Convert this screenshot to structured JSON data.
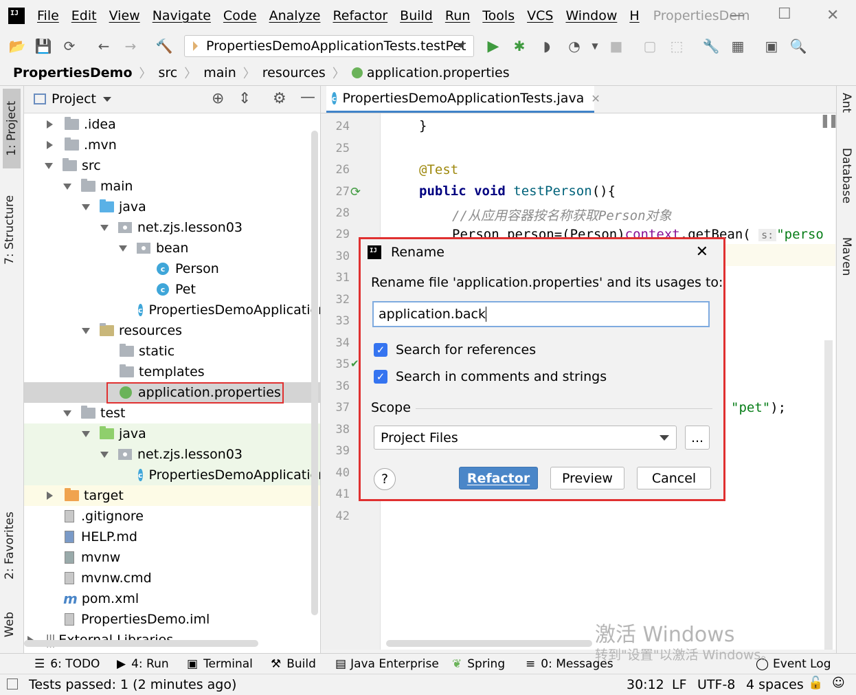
{
  "menubar": {
    "items": [
      "File",
      "Edit",
      "View",
      "Navigate",
      "Code",
      "Analyze",
      "Refactor",
      "Build",
      "Run",
      "Tools",
      "VCS",
      "Window",
      "H"
    ],
    "title": "PropertiesDem"
  },
  "toolbar": {
    "run_config": "PropertiesDemoApplicationTests.testPet"
  },
  "breadcrumb": [
    "PropertiesDemo",
    "src",
    "main",
    "resources",
    "application.properties"
  ],
  "left_tabs": {
    "project": "1: Project",
    "structure": "7: Structure",
    "favorites": "2: Favorites",
    "web": "Web"
  },
  "project_panel": {
    "title": "Project",
    "tree": [
      {
        "label": ".idea"
      },
      {
        "label": ".mvn"
      },
      {
        "label": "src"
      },
      {
        "label": "main"
      },
      {
        "label": "java"
      },
      {
        "label": "net.zjs.lesson03"
      },
      {
        "label": "bean"
      },
      {
        "label": "Person"
      },
      {
        "label": "Pet"
      },
      {
        "label": "PropertiesDemoApplication"
      },
      {
        "label": "resources"
      },
      {
        "label": "static"
      },
      {
        "label": "templates"
      },
      {
        "label": "application.properties"
      },
      {
        "label": "test"
      },
      {
        "label": "java"
      },
      {
        "label": "net.zjs.lesson03"
      },
      {
        "label": "PropertiesDemoApplication"
      },
      {
        "label": "target"
      },
      {
        "label": ".gitignore"
      },
      {
        "label": "HELP.md"
      },
      {
        "label": "mvnw"
      },
      {
        "label": "mvnw.cmd"
      },
      {
        "label": "pom.xml"
      },
      {
        "label": "PropertiesDemo.iml"
      },
      {
        "label": "External Libraries"
      }
    ]
  },
  "editor": {
    "tab": "PropertiesDemoApplicationTests.java",
    "line_numbers": [
      "24",
      "25",
      "26",
      "27",
      "28",
      "29",
      "30",
      "31",
      "32",
      "33",
      "34",
      "35",
      "36",
      "37",
      "38",
      "39",
      "40",
      "41",
      "42"
    ],
    "code": {
      "l24": "}",
      "l26": "@Test",
      "l27_kw": "public void",
      "l27_name": "testPerson",
      "l27_rest": "(){",
      "l28": "//从应用容器按名称获取Person对象",
      "l29_a": "Person person=(Person)",
      "l29_b": "context",
      "l29_c": ".getBean(",
      "l29_hint": "s:",
      "l29_str": "\"perso",
      "l37_str": "\"pet\"",
      "l37_end": ");"
    }
  },
  "right_tabs": {
    "ant": "Ant",
    "database": "Database",
    "maven": "Maven"
  },
  "dialog": {
    "title": "Rename",
    "prompt": "Rename file 'application.properties' and its usages to:",
    "input_value": "application.back",
    "search_references": "Search for references",
    "search_comments": "Search in comments and strings",
    "scope_label": "Scope",
    "scope_value": "Project Files",
    "more": "...",
    "help": "?",
    "refactor": "Refactor",
    "preview": "Preview",
    "cancel": "Cancel"
  },
  "bottom_tabs": {
    "todo": "6: TODO",
    "run": "4: Run",
    "terminal": "Terminal",
    "build": "Build",
    "java_enterprise": "Java Enterprise",
    "spring": "Spring",
    "messages": "0: Messages",
    "event_log": "Event Log"
  },
  "status": {
    "message": "Tests passed: 1 (2 minutes ago)",
    "position": "30:12",
    "line_sep": "LF",
    "encoding": "UTF-8",
    "indent": "4 spaces"
  },
  "watermark": {
    "line1": "激活 Windows",
    "line2": "转到\"设置\"以激活 Windows。"
  },
  "colors": {
    "accent": "#4a86c8",
    "highlight_border": "#e03030",
    "test_bg": "#eef7e8"
  }
}
